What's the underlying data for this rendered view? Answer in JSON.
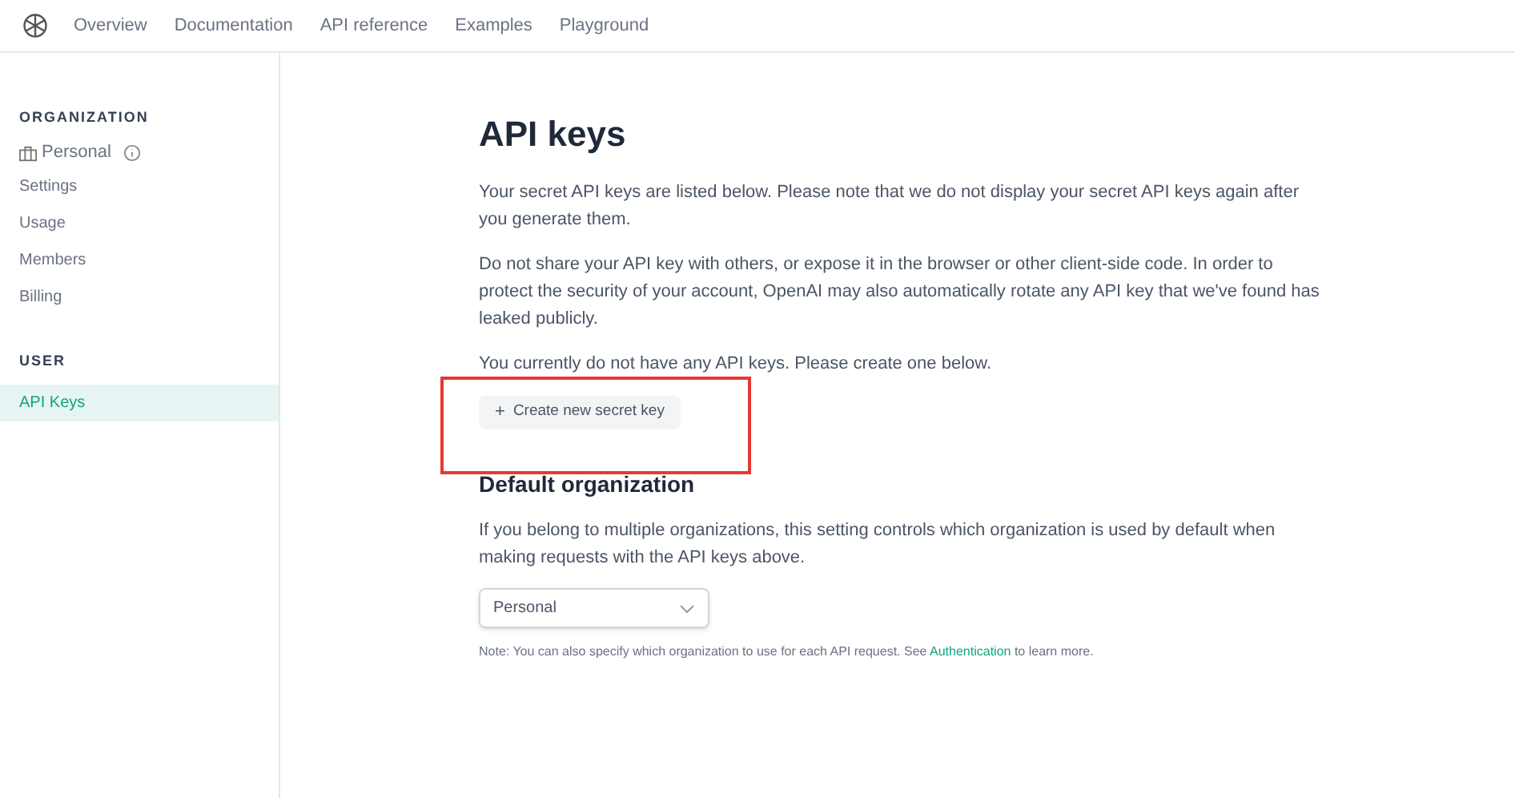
{
  "nav": {
    "items": [
      {
        "label": "Overview",
        "selected": false
      },
      {
        "label": "Documentation",
        "selected": false
      },
      {
        "label": "API reference",
        "selected": false
      },
      {
        "label": "Examples",
        "selected": false
      },
      {
        "label": "Playground",
        "selected": false
      }
    ]
  },
  "sidebar": {
    "sections": [
      {
        "heading": "ORGANIZATION",
        "org": "Personal",
        "items": [
          {
            "label": "Settings",
            "selected": false
          },
          {
            "label": "Usage",
            "selected": false
          },
          {
            "label": "Members",
            "selected": false
          },
          {
            "label": "Billing",
            "selected": false
          }
        ]
      },
      {
        "heading": "USER",
        "items": [
          {
            "label": "API Keys",
            "selected": true
          }
        ]
      }
    ]
  },
  "main": {
    "title": "API keys",
    "paragraphs": [
      "Your secret API keys are listed below. Please note that we do not display your secret API keys again after you generate them.",
      "Do not share your API key with others, or expose it in the browser or other client-side code. In order to protect the security of your account, OpenAI may also automatically rotate any API key that we've found has leaked publicly.",
      "You currently do not have any API keys. Please create one below."
    ],
    "create_button": {
      "icon": "+",
      "label": "Create new secret key"
    },
    "default_org": {
      "heading": "Default organization",
      "description": "If you belong to multiple organizations, this setting controls which organization is used by default when making requests with the API keys above.",
      "select_value": "Personal",
      "note_before": "Note: You can also specify which organization to use for each API request. See ",
      "note_link": "Authentication",
      "note_after": " to learn more."
    }
  }
}
